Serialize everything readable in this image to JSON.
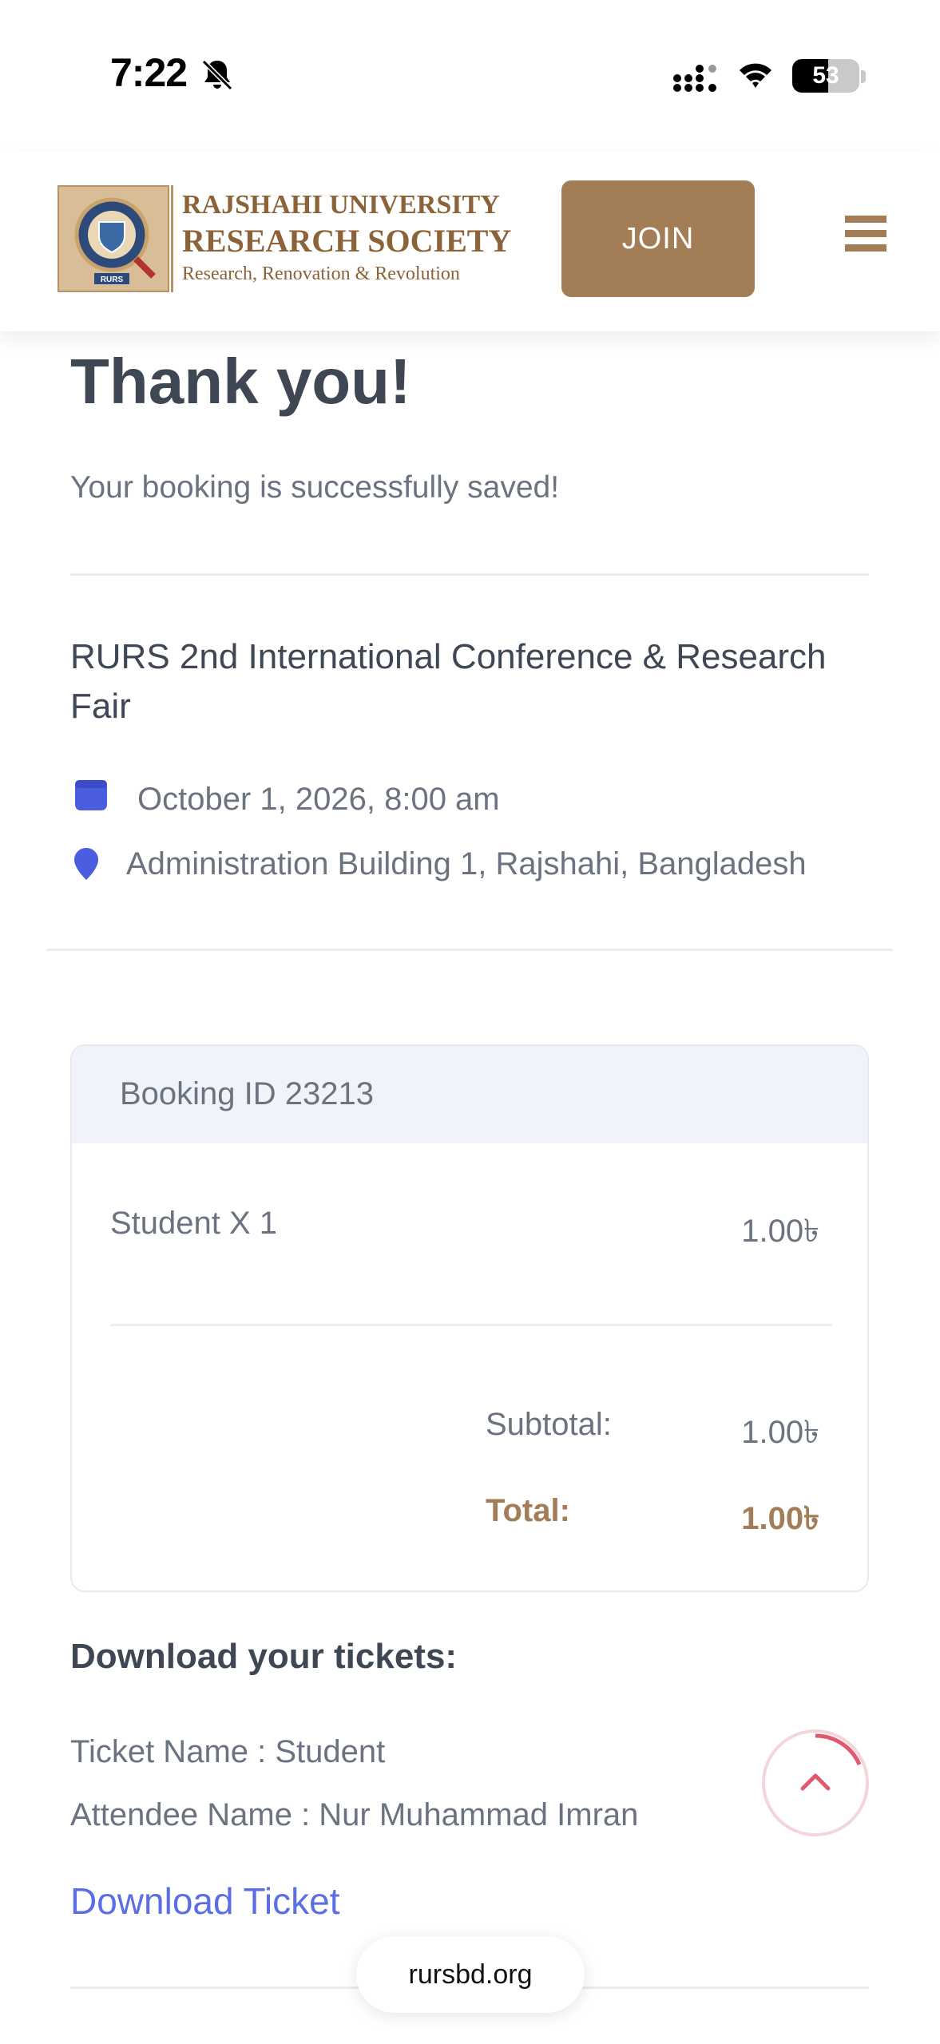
{
  "status_bar": {
    "time": "7:22",
    "battery": "53",
    "battery_level": 0.53
  },
  "header": {
    "logo_line1": "RAJSHAHI UNIVERSITY",
    "logo_line2": "RESEARCH SOCIETY",
    "logo_line3": "Research, Renovation & Revolution",
    "logo_badge": "RURS",
    "join_label": "JOIN",
    "brand_color": "#a27d55"
  },
  "confirmation": {
    "title": "Thank you!",
    "message": "Your booking is successfully saved!"
  },
  "event": {
    "title": "RURS 2nd International Conference & Research Fair",
    "date": "October 1, 2026, 8:00 am",
    "location": "Administration Building 1, Rajshahi, Bangladesh",
    "icon_color": "#4a5de0"
  },
  "booking": {
    "id_label": "Booking ID 23213",
    "item_name": "Student X 1",
    "item_price": "1.00৳",
    "subtotal_label": "Subtotal:",
    "subtotal_value": "1.00৳",
    "total_label": "Total:",
    "total_value": "1.00৳"
  },
  "tickets": {
    "heading": "Download your tickets:",
    "ticket_name": "Ticket Name : Student",
    "attendee_name": "Attendee Name : Nur Muhammad Imran",
    "download_label": "Download Ticket"
  },
  "browser": {
    "url": "rursbd.org"
  },
  "icons": {
    "bell": "bell-slash-icon",
    "signal": "cellular-signal-icon",
    "wifi": "wifi-icon",
    "menu": "hamburger-menu-icon",
    "calendar": "calendar-icon",
    "location": "map-pin-icon",
    "scroll_top": "chevron-up-icon"
  }
}
